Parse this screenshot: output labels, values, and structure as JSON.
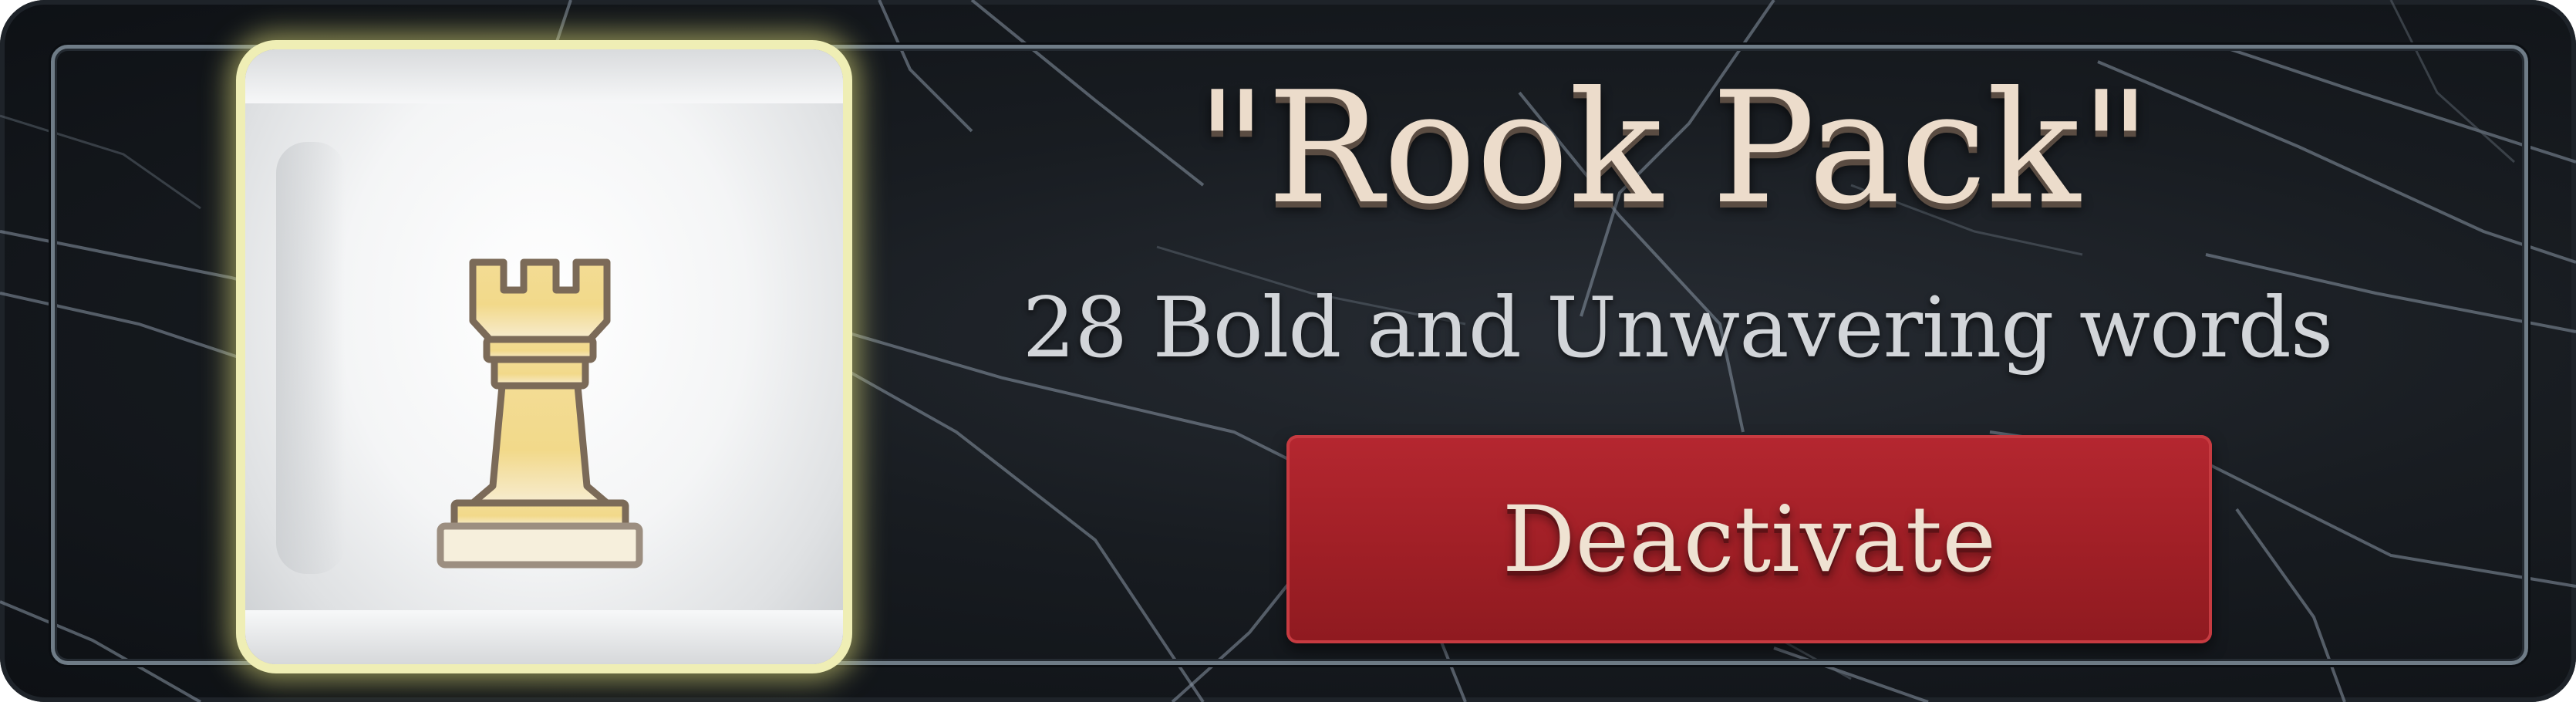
{
  "pack": {
    "title": "\"Rook Pack\"",
    "subtitle": "28 Bold and Unwavering words",
    "button_label": "Deactivate",
    "icon": "rook-icon"
  },
  "colors": {
    "title_text": "#ecdccb",
    "subtitle_text": "#d2d5d9",
    "button_background": "#a01f26",
    "button_text": "#efe2d2",
    "pack_glow": "#efeeb5",
    "background": "#181c21"
  }
}
